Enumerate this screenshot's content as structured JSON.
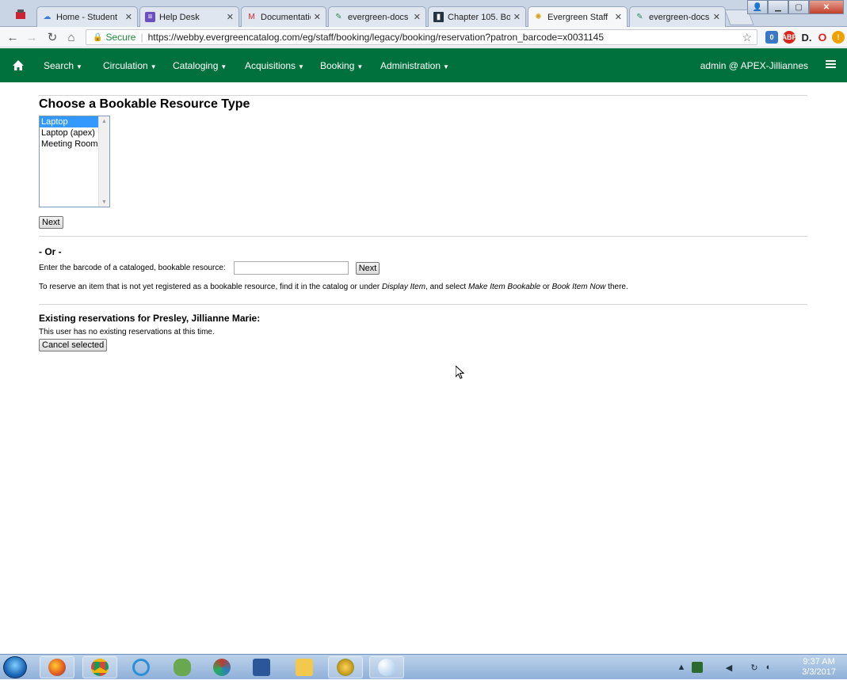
{
  "browser": {
    "tabs": [
      {
        "title": "Home - Student",
        "active": false
      },
      {
        "title": "Help Desk",
        "active": false
      },
      {
        "title": "Documentation",
        "active": false
      },
      {
        "title": "evergreen-docs",
        "active": false
      },
      {
        "title": "Chapter 105. Bo",
        "active": false
      },
      {
        "title": "Evergreen Staff",
        "active": true
      },
      {
        "title": "evergreen-docs",
        "active": false
      }
    ],
    "secure_label": "Secure",
    "url": "https://webby.evergreencatalog.com/eg/staff/booking/legacy/booking/reservation?patron_barcode=x0031145",
    "ext_badge_count": "0"
  },
  "appnav": {
    "menus": [
      "Search",
      "Circulation",
      "Cataloging",
      "Acquisitions",
      "Booking",
      "Administration"
    ],
    "user": "admin @ APEX-Jilliannes"
  },
  "page": {
    "heading": "Choose a Bookable Resource Type",
    "resource_types": [
      "Laptop",
      "Laptop (apex)",
      "Meeting Room"
    ],
    "selected_type": "Laptop",
    "next_label": "Next",
    "or_label": "- Or -",
    "barcode_prompt": "Enter the barcode of a cataloged, bookable resource:",
    "barcode_value": "",
    "barcode_next_label": "Next",
    "help_before": "To reserve an item that is not yet registered as a bookable resource, find it in the catalog or under ",
    "help_display_item": "Display Item",
    "help_middle": ", and select ",
    "help_make_bookable": "Make Item Bookable",
    "help_or": " or ",
    "help_book_now": "Book Item Now",
    "help_after": " there.",
    "existing_heading": "Existing reservations for Presley, Jillianne Marie:",
    "no_reservations": "This user has no existing reservations at this time.",
    "cancel_label": "Cancel selected"
  },
  "taskbar": {
    "time": "9:37 AM",
    "date": "3/3/2017"
  },
  "colors": {
    "nav_green": "#00703c",
    "selected_blue": "#3399ff"
  }
}
